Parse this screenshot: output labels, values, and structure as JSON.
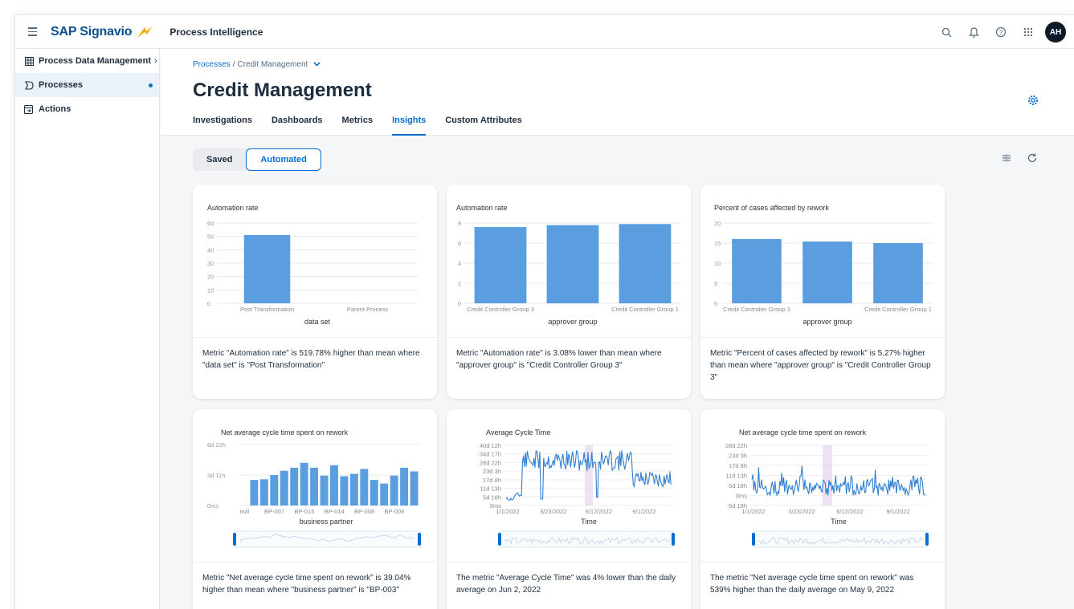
{
  "shell": {
    "brand": "SAP Signavio",
    "product": "Process Intelligence",
    "avatar_initials": "AH",
    "icons": [
      "menu-icon",
      "search-icon",
      "bell-icon",
      "help-icon",
      "grid-icon"
    ]
  },
  "sidebar": {
    "items": [
      {
        "label": "Process Data Management",
        "icon": "table-icon",
        "chevron": "›"
      },
      {
        "label": "Processes",
        "icon": "process-icon"
      },
      {
        "label": "Actions",
        "icon": "actions-icon"
      }
    ]
  },
  "header": {
    "breadcrumb_root": "Processes",
    "breadcrumb_sep": "/",
    "breadcrumb_current": "Credit Management",
    "title": "Credit Management",
    "tabs": [
      "Investigations",
      "Dashboards",
      "Metrics",
      "Insights",
      "Custom Attributes"
    ],
    "active_tab": "Insights"
  },
  "content": {
    "segments": [
      "Saved",
      "Automated"
    ],
    "selected_segment": "Automated"
  },
  "colors": {
    "accent": "#0a6ed1",
    "bar": "#5b9ee0",
    "highlight": "#e5d4f0"
  },
  "cards": [
    {
      "insight": "Metric \"Automation rate\" is 519.78% higher than mean where \"data set\" is \"Post Transformation\""
    },
    {
      "insight": "Metric \"Automation rate\" is 3.08% lower than mean where \"approver group\" is \"Credit Controller Group 3\""
    },
    {
      "insight": "Metric \"Percent of cases affected by rework\" is 5.27% higher than mean where \"approver group\" is \"Credit Controller Group 3\""
    },
    {
      "insight": "Metric \"Net average cycle time spent on rework\" is 39.04% higher than mean where \"business partner\" is \"BP-003\""
    },
    {
      "insight": "The metric \"Average Cycle Time\" was 4% lower than the daily average on Jun 2, 2022"
    },
    {
      "insight": "The metric \"Net average cycle time spent on rework\" was 539% higher than the daily average on May 9, 2022"
    }
  ],
  "chart_data": [
    {
      "type": "bar",
      "title": "Automation rate",
      "xlabel": "data set",
      "categories": [
        "Post Transformation",
        "Parent Process"
      ],
      "values": [
        51,
        0
      ],
      "yticks": [
        "60",
        "50",
        "40",
        "30",
        "20",
        "10",
        "0"
      ],
      "ylim": [
        0,
        60
      ]
    },
    {
      "type": "bar",
      "title": "Automation rate",
      "xlabel": "approver group",
      "categories": [
        "Credit Controller Group 3",
        "",
        "Credit Controller Group 1"
      ],
      "values": [
        7.6,
        7.8,
        7.9
      ],
      "yticks": [
        "8",
        "6",
        "4",
        "2",
        "0"
      ],
      "ylim": [
        0,
        8
      ]
    },
    {
      "type": "bar",
      "title": "Percent of cases affected by rework",
      "xlabel": "approver group",
      "categories": [
        "Credit Controller Group 3",
        "",
        "Credit Controller Group 1"
      ],
      "values": [
        16,
        15.4,
        15
      ],
      "yticks": [
        "20",
        "15",
        "10",
        "5",
        "0"
      ],
      "ylim": [
        0,
        20
      ]
    },
    {
      "type": "bar",
      "title": "Net average cycle time spent on rework",
      "xlabel": "business partner",
      "tick_labels": [
        "null",
        "BP-007",
        "BP-015",
        "BP-014",
        "BP-008",
        "BP-006"
      ],
      "values": [
        0,
        0.42,
        0.43,
        0.5,
        0.57,
        0.62,
        0.7,
        0.62,
        0.49,
        0.66,
        0.48,
        0.52,
        0.6,
        0.42,
        0.36,
        0.49,
        0.62,
        0.56
      ],
      "yticks": [
        "6d 22h",
        "3d 11h",
        "0ms"
      ],
      "ylim": [
        0,
        1
      ]
    },
    {
      "type": "line",
      "title": "Average Cycle Time",
      "xlabel": "Time",
      "xticks": [
        "1/1/2022",
        "3/23/2022",
        "6/12/2022",
        "9/1/2022"
      ],
      "yticks": [
        "40d 12h",
        "34d 17h",
        "28d 22h",
        "23d 3h",
        "17d 8h",
        "11d 13h",
        "5d 18h",
        "0ms"
      ],
      "highlight_date": "6/2/2022"
    },
    {
      "type": "line",
      "title": "Net average cycle time spent on rework",
      "xlabel": "Time",
      "xticks": [
        "1/1/2022",
        "3/23/2022",
        "6/12/2022",
        "9/1/2022"
      ],
      "yticks": [
        "28d 22h",
        "23d 3h",
        "17d 8h",
        "11d 13h",
        "5d 18h",
        "0ms",
        "-5d 18h"
      ],
      "highlight_date": "5/9/2022"
    }
  ]
}
